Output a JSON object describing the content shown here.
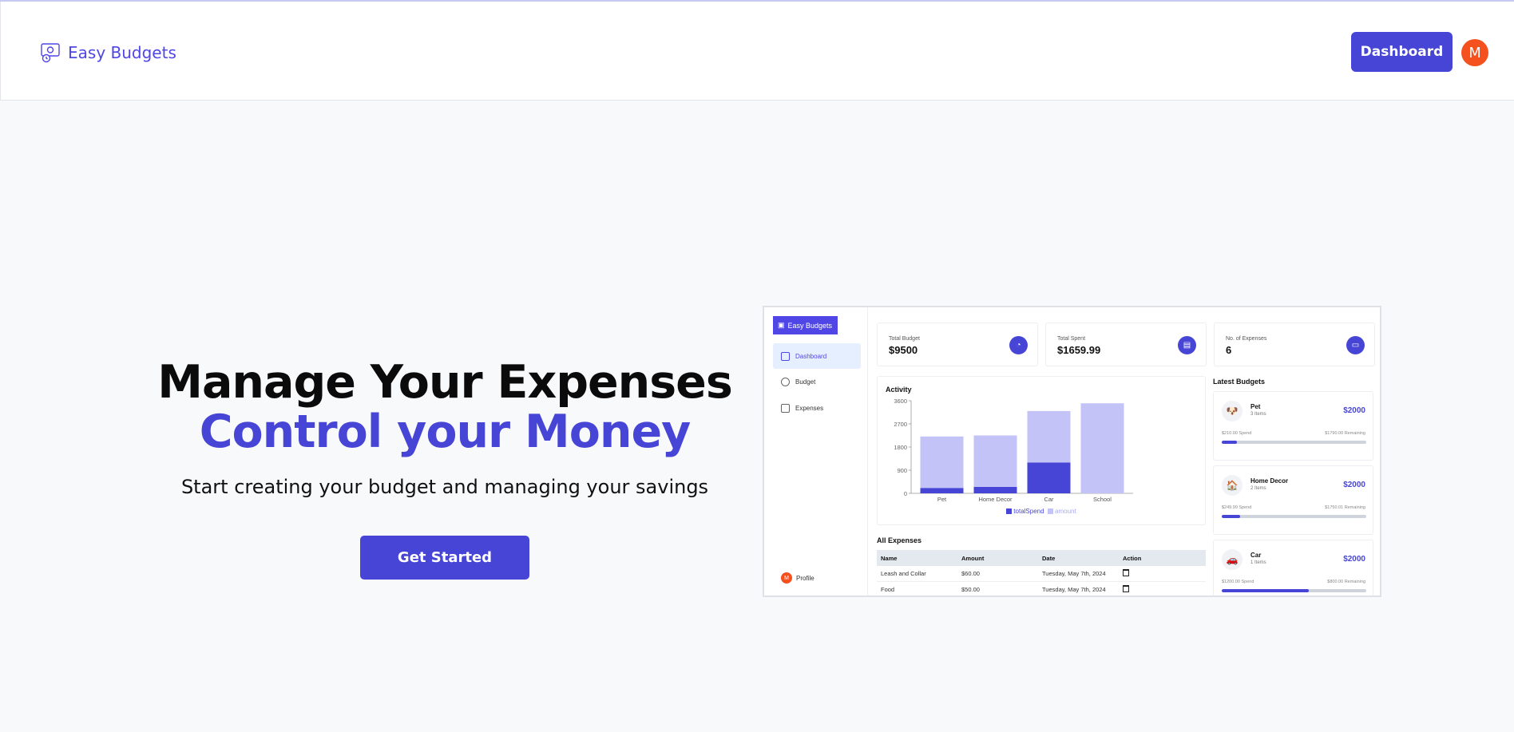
{
  "header": {
    "brand": "Easy Budgets",
    "dashboard_button": "Dashboard",
    "avatar_letter": "M"
  },
  "hero": {
    "title_line1": "Manage Your Expenses",
    "title_line2": "Control your Money",
    "subtitle": "Start creating your budget and managing your savings",
    "cta": "Get Started"
  },
  "colors": {
    "accent": "#4745d6",
    "accent_light": "#c4c3f7",
    "avatar": "#f4511e",
    "background": "#f8f9fb"
  },
  "preview": {
    "brand": "Easy Budgets",
    "nav": [
      {
        "label": "Dashboard",
        "icon": "grid-icon",
        "active": true
      },
      {
        "label": "Budget",
        "icon": "piggy-bank-icon",
        "active": false
      },
      {
        "label": "Expenses",
        "icon": "receipt-icon",
        "active": false
      }
    ],
    "profile": {
      "label": "Profile",
      "avatar_letter": "M"
    },
    "cards": [
      {
        "label": "Total Budget",
        "value": "$9500",
        "icon": "piggy-bank-icon"
      },
      {
        "label": "Total Spent",
        "value": "$1659.99",
        "icon": "receipt-icon"
      },
      {
        "label": "No. of Expenses",
        "value": "6",
        "icon": "wallet-icon"
      }
    ],
    "activity_title": "Activity",
    "all_expenses_title": "All Expenses",
    "table": {
      "headers": [
        "Name",
        "Amount",
        "Date",
        "Action"
      ],
      "rows": [
        [
          "Leash and Collar",
          "$60.00",
          "Tuesday, May 7th, 2024"
        ],
        [
          "Food",
          "$50.00",
          "Tuesday, May 7th, 2024"
        ]
      ]
    },
    "latest_budgets_title": "Latest Budgets",
    "budgets": [
      {
        "name": "Pet",
        "items": "3 Items",
        "amount": "$2000",
        "spend": "$210.00 Spend",
        "remaining": "$1790.00 Remaining",
        "progress": 0.105,
        "icon": "dog-emoji-icon"
      },
      {
        "name": "Home Decor",
        "items": "2 Items",
        "amount": "$2000",
        "spend": "$249.99 Spend",
        "remaining": "$1750.01 Remaining",
        "progress": 0.125,
        "icon": "house-emoji-icon"
      },
      {
        "name": "Car",
        "items": "1 Items",
        "amount": "$2000",
        "spend": "$1200.00 Spend",
        "remaining": "$800.00 Remaining",
        "progress": 0.6,
        "icon": "car-emoji-icon"
      }
    ]
  },
  "chart_data": {
    "type": "bar",
    "title": "Activity",
    "categories": [
      "Pet",
      "Home Decor",
      "Car",
      "School"
    ],
    "series": [
      {
        "name": "totalSpend",
        "values": [
          210,
          250,
          1200,
          0
        ],
        "color": "#4745d6"
      },
      {
        "name": "amount",
        "values": [
          2000,
          2000,
          2000,
          3500
        ],
        "color": "#c4c3f7"
      }
    ],
    "yticks": [
      0,
      900,
      1800,
      2700,
      3600
    ],
    "ylim": [
      0,
      3600
    ],
    "stacked": true,
    "legend": "bottom"
  }
}
